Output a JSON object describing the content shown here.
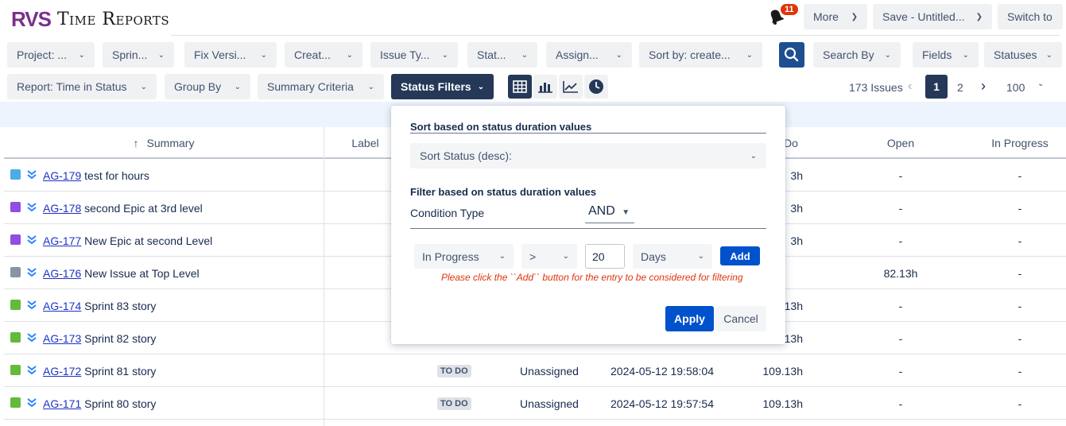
{
  "header": {
    "brand": "RVS",
    "app_title": "Time Reports",
    "notification_count": "11",
    "more_label": "More",
    "save_label": "Save - Untitled...",
    "switch_label": "Switch to"
  },
  "filters": [
    {
      "label": "Project: ..."
    },
    {
      "label": "Sprin..."
    },
    {
      "label": "Fix Versi..."
    },
    {
      "label": "Creat..."
    },
    {
      "label": "Issue Ty..."
    },
    {
      "label": "Stat..."
    },
    {
      "label": "Assign..."
    },
    {
      "label": "Sort by: create..."
    }
  ],
  "search_by_label": "Search By",
  "fields_label": "Fields",
  "statuses_label": "Statuses",
  "toolbar": {
    "report_label": "Report: Time in Status",
    "group_by_label": "Group By",
    "summary_criteria_label": "Summary Criteria",
    "status_filters_label": "Status Filters"
  },
  "pager": {
    "issue_count": "173 Issues",
    "page_1": "1",
    "page_2": "2",
    "page_size": "100"
  },
  "table": {
    "headers": {
      "summary": "Summary",
      "sort_arrow": "↑",
      "label": "Label",
      "todo": "Do",
      "open": "Open",
      "in_progress": "In Progress"
    },
    "rows": [
      {
        "key": "AG-179",
        "summary": "test for hours",
        "type_color": "#4bade8",
        "status": "",
        "assignee": "",
        "created": "",
        "todo": "3h",
        "open": "-",
        "in_progress": "-"
      },
      {
        "key": "AG-178",
        "summary": "second Epic at 3rd level",
        "type_color": "#904ee2",
        "status": "",
        "assignee": "",
        "created": "",
        "todo": "3h",
        "open": "-",
        "in_progress": "-"
      },
      {
        "key": "AG-177",
        "summary": "New Epic at second Level",
        "type_color": "#904ee2",
        "status": "",
        "assignee": "",
        "created": "",
        "todo": "3h",
        "open": "-",
        "in_progress": "-"
      },
      {
        "key": "AG-176",
        "summary": "New Issue at Top Level",
        "type_color": "#8993a4",
        "status": "",
        "assignee": "",
        "created": "",
        "todo": "",
        "open": "82.13h",
        "in_progress": "-"
      },
      {
        "key": "AG-174",
        "summary": "Sprint 83 story",
        "type_color": "#63ba3c",
        "status": "",
        "assignee": "",
        "created": "",
        "todo": ".13h",
        "open": "-",
        "in_progress": "-"
      },
      {
        "key": "AG-173",
        "summary": "Sprint 82 story",
        "type_color": "#63ba3c",
        "status": "",
        "assignee": "",
        "created": "",
        "todo": ".13h",
        "open": "-",
        "in_progress": "-"
      },
      {
        "key": "AG-172",
        "summary": "Sprint 81 story",
        "type_color": "#63ba3c",
        "status": "TO DO",
        "assignee": "Unassigned",
        "created": "2024-05-12 19:58:04",
        "todo": "109.13h",
        "open": "-",
        "in_progress": "-"
      },
      {
        "key": "AG-171",
        "summary": "Sprint 80 story",
        "type_color": "#63ba3c",
        "status": "TO DO",
        "assignee": "Unassigned",
        "created": "2024-05-12 19:57:54",
        "todo": "109.13h",
        "open": "-",
        "in_progress": "-"
      }
    ]
  },
  "popup": {
    "sort_title": "Sort based on status duration values",
    "sort_select": "Sort Status (desc):",
    "filter_title": "Filter based on status duration values",
    "condition_label": "Condition Type",
    "condition_value": "AND",
    "status_select": "In Progress",
    "operator_select": ">",
    "value_input": "20",
    "unit_select": "Days",
    "add_label": "Add",
    "warning": "Please click the ``Add`` button for the entry to be considered for filtering",
    "apply_label": "Apply",
    "cancel_label": "Cancel"
  },
  "colors": {
    "dark_button": "#253858",
    "primary": "#0052cc",
    "link": "#1d33c4",
    "warning": "#de350b"
  }
}
